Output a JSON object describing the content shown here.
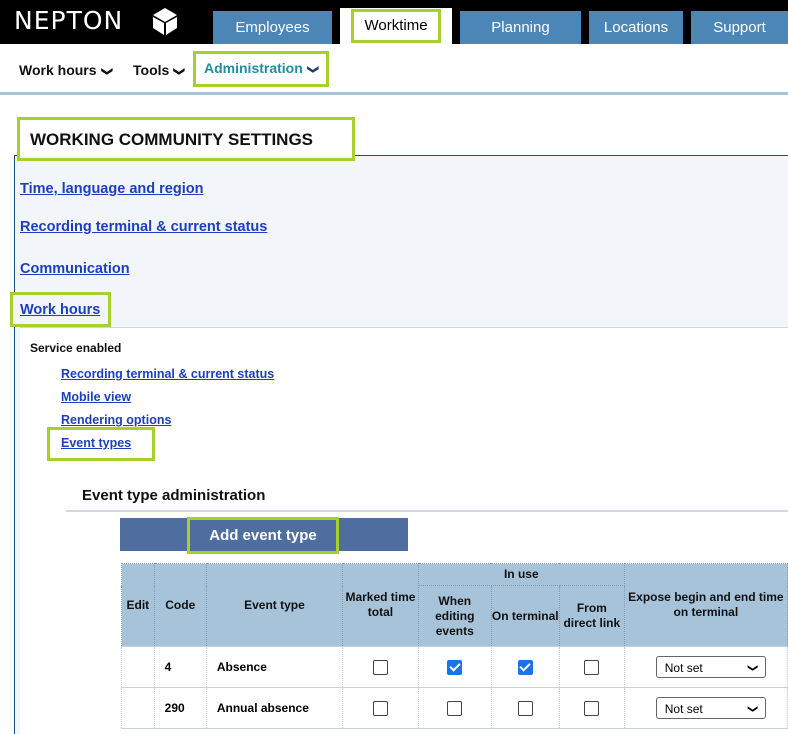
{
  "brand": {
    "name": "NEPTON"
  },
  "tabs": [
    "Employees",
    "Worktime",
    "Planning",
    "Locations",
    "Support"
  ],
  "subnav": {
    "work_hours": "Work hours",
    "tools": "Tools",
    "administration": "Administration"
  },
  "panel": {
    "title": "WORKING COMMUNITY SETTINGS",
    "links": [
      "Time, language and region",
      "Recording terminal & current status",
      "Communication",
      "Work hours"
    ]
  },
  "work_hours_section": {
    "service_label": "Service enabled",
    "links": [
      "Recording terminal & current status",
      "Mobile view",
      "Rendering options",
      "Event types"
    ]
  },
  "event_types": {
    "heading": "Event type administration",
    "add_button": "Add event type",
    "columns": {
      "edit": "Edit",
      "code": "Code",
      "event_type": "Event type",
      "marked_time_total": "Marked time total",
      "in_use": "In use",
      "when_editing": "When editing events",
      "on_terminal": "On terminal",
      "from_direct_link": "From direct link",
      "expose": "Expose begin and end time on terminal"
    },
    "rows": [
      {
        "code": "4",
        "name": "Absence",
        "marked_time_total": false,
        "when_editing": true,
        "on_terminal": true,
        "from_direct_link": false,
        "expose": "Not set"
      },
      {
        "code": "290",
        "name": "Annual absence",
        "marked_time_total": false,
        "when_editing": false,
        "on_terminal": false,
        "from_direct_link": false,
        "expose": "Not set"
      }
    ]
  },
  "colors": {
    "highlight": "#a6d12b",
    "tab_blue": "#4b86b6",
    "link_blue": "#1d3fbd",
    "header_blue": "#a7c3da",
    "button_blue": "#4f6ea0"
  }
}
